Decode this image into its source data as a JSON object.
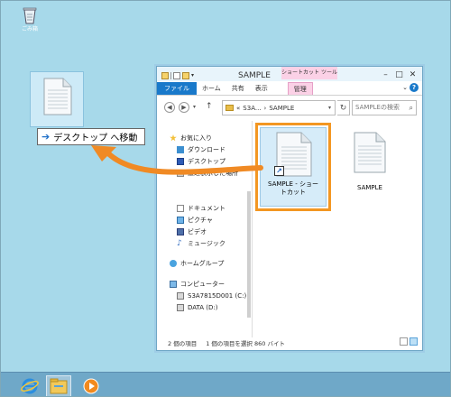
{
  "desktop": {
    "recycle_bin_label": "ごみ箱",
    "drag_tooltip": {
      "arrow": "➔",
      "text": "デスクトップ へ移動"
    }
  },
  "window": {
    "title": "SAMPLE",
    "context_tab_title": "ショートカット ツール",
    "controls": {
      "minimize": "–",
      "maximize": "□",
      "close": "✕"
    },
    "ribbon_tabs": [
      "ファイル",
      "ホーム",
      "共有",
      "表示",
      "管理"
    ],
    "ribbon_expand": "⌄",
    "help": "?",
    "address": {
      "back": "◀",
      "forward": "▶",
      "dropdown": "▾",
      "up": "↑",
      "breadcrumb_prefix": "«",
      "path_1": "S3A...",
      "sep": "›",
      "path_2": "SAMPLE",
      "refresh": "↻",
      "search_placeholder": "SAMPLEの検索",
      "search_icon": "⌕"
    },
    "nav_pane": {
      "favorites": "お気に入り",
      "downloads": "ダウンロード",
      "desktop": "デスクトップ",
      "recent": "最近表示した場所",
      "documents": "ドキュメント",
      "pictures": "ピクチャ",
      "videos": "ビデオ",
      "music": "ミュージック",
      "homegroup": "ホームグループ",
      "computer": "コンピューター",
      "drive_c": "S3A7815D001 (C:)",
      "drive_d": "DATA (D:)"
    },
    "files": [
      {
        "name": "SAMPLE - ショー\nトカット",
        "type": "shortcut",
        "selected": true
      },
      {
        "name": "SAMPLE",
        "type": "document",
        "selected": false
      }
    ],
    "status": {
      "count": "2 個の項目",
      "selection": "1 個の項目を選択  860 バイト"
    }
  },
  "colors": {
    "desktop_bg": "#a7d9ea",
    "highlight": "#f39722",
    "accent": "#1979ca",
    "context_tab": "#fbd1e6"
  },
  "taskbar": {
    "items": [
      "ie-icon",
      "file-explorer-icon",
      "media-player-icon"
    ]
  }
}
